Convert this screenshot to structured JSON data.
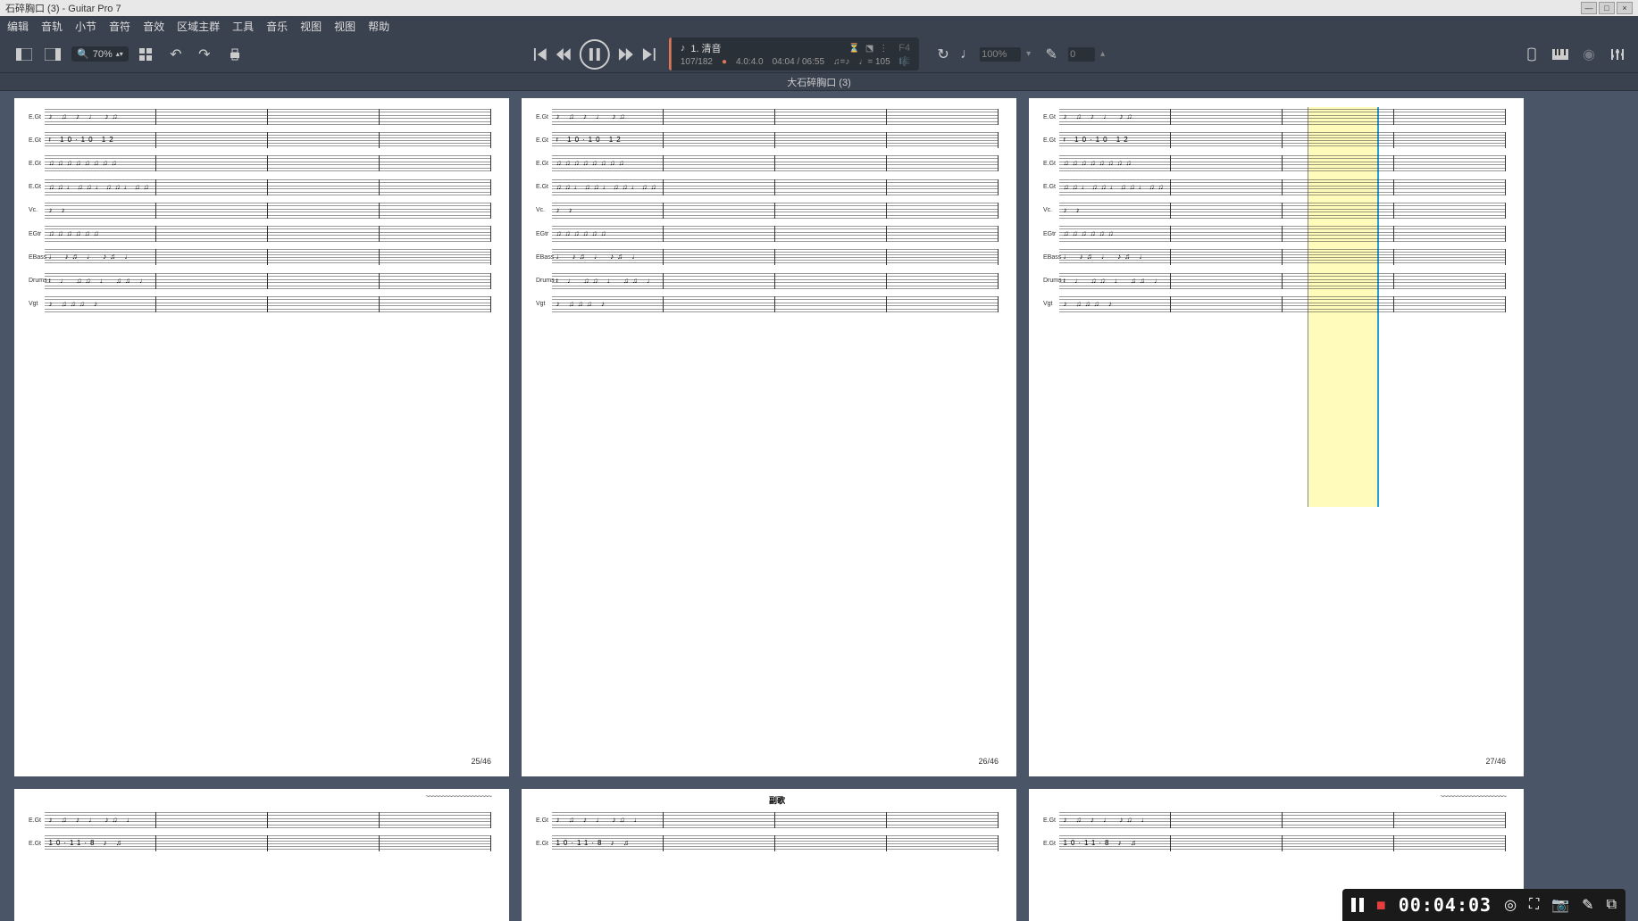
{
  "window": {
    "title": "石碎胸口 (3) - Guitar Pro 7"
  },
  "menu": {
    "items": [
      "编辑",
      "音轨",
      "小节",
      "音符",
      "音效",
      "区域主群",
      "工具",
      "音乐",
      "视图",
      "视图",
      "帮助"
    ]
  },
  "toolbar": {
    "zoom": "70%"
  },
  "now_playing": {
    "track_label": "1. 清音",
    "bar_position": "107/182",
    "time_sig": "4.0:4.0",
    "time_position": "04:04 / 06:55",
    "tempo_marker": "♩= 105",
    "note_display": "F4"
  },
  "loop": {
    "speed": "100%",
    "transpose": "0"
  },
  "tab": {
    "document_name": "大石碎胸口 (3)"
  },
  "tracks": [
    "E.Gt",
    "E.Gt",
    "E.Gt",
    "E.Gt",
    "Vc.",
    "EGtr",
    "EBass",
    "Drums",
    "Vgt"
  ],
  "pages": [
    {
      "number": "25/46"
    },
    {
      "number": "26/46"
    },
    {
      "number": "27/46"
    }
  ],
  "section_marker": "副歌",
  "recorder": {
    "elapsed": "00:04:03"
  }
}
